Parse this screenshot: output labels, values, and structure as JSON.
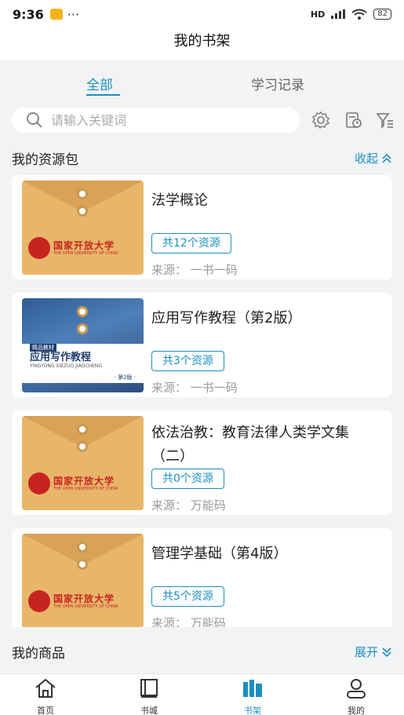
{
  "status_bar": {
    "time": "9:36",
    "dots": "···",
    "network": "HD",
    "battery": "82"
  },
  "header": {
    "title": "我的书架"
  },
  "tabs": [
    {
      "label": "全部",
      "active": true
    },
    {
      "label": "学习记录",
      "active": false
    }
  ],
  "search": {
    "placeholder": "请输入关键词"
  },
  "toolbar": {
    "icons": [
      "settings-icon",
      "history-icon",
      "filter-icon"
    ]
  },
  "resource_section": {
    "title": "我的资源包",
    "action": "收起"
  },
  "items": [
    {
      "title": "法学概论",
      "badge": "共12个资源",
      "source": "来源：  一书一码",
      "cover": "envelope"
    },
    {
      "title": "应用写作教程（第2版）",
      "badge": "共3个资源",
      "source": "来源：  一书一码",
      "cover": "book"
    },
    {
      "title": "依法治教：教育法律人类学文集（二）",
      "badge": "共0个资源",
      "source": "来源：  万能码",
      "cover": "envelope"
    },
    {
      "title": "管理学基础（第4版）",
      "badge": "共5个资源",
      "source": "来源：  万能码",
      "cover": "envelope"
    }
  ],
  "cover_text": {
    "university": "国家开放大学",
    "university_en": "THE OPEN UNIVERSITY OF CHINA",
    "book_series": "精品教材",
    "book_title": "应用写作教程",
    "book_pinyin": "YINGYONG XIEZUO JIAOCHENG",
    "book_edition": "· 第2版 ·"
  },
  "goods_section": {
    "title": "我的商品",
    "action": "展开"
  },
  "bottom_nav": [
    {
      "label": "首页",
      "icon": "home-icon",
      "active": false
    },
    {
      "label": "书城",
      "icon": "book-icon",
      "active": false
    },
    {
      "label": "书架",
      "icon": "bookshelf-icon",
      "active": true
    },
    {
      "label": "我的",
      "icon": "user-icon",
      "active": false
    }
  ],
  "colors": {
    "accent": "#1c8fbf",
    "envelope": "#e8b66b",
    "logo_red": "#c8241f"
  }
}
